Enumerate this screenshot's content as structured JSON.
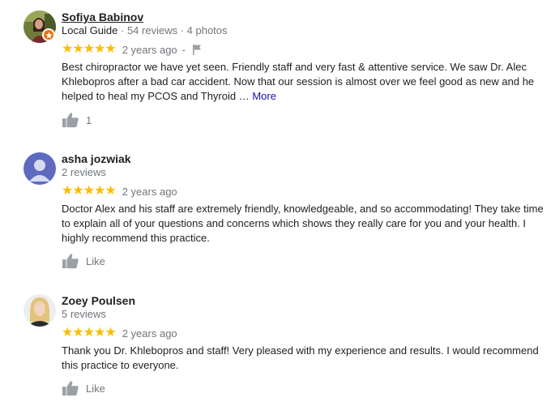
{
  "reviews": [
    {
      "name": "Sofiya Babinov",
      "guide_label": "Local Guide",
      "meta": "· 54 reviews · 4 photos",
      "stars": "★★★★★",
      "rating": 5,
      "time": "2 years ago",
      "separator": "-",
      "text": "Best chiropractor we have yet seen. Friendly staff and very fast & attentive service. We saw Dr. Alec Khlebopros after a bad car accident. Now that our session is almost over we feel good as new and he helped to heal my PCOS and Thyroid … ",
      "more_label": "More",
      "like_label": "1"
    },
    {
      "name": "asha jozwiak",
      "meta": "2 reviews",
      "stars": "★★★★★",
      "rating": 5,
      "time": "2 years ago",
      "text": "Doctor Alex and his staff are extremely friendly, knowledgeable, and so accommodating! They take time to explain all of your questions and concerns which shows they really care for you and your health. I highly recommend this practice.",
      "like_label": "Like"
    },
    {
      "name": "Zoey Poulsen",
      "meta": "5 reviews",
      "stars": "★★★★★",
      "rating": 5,
      "time": "2 years ago",
      "text": "Thank you Dr. Khlebopros and staff! Very pleased with my experience and results. I would recommend this practice to everyone.",
      "like_label": "Like"
    }
  ],
  "colors": {
    "star": "#fbbc04",
    "more_link": "#1a0dab",
    "muted": "#70757a",
    "guide_badge": "#e8710a",
    "default_avatar": "#5c6bc0"
  },
  "icons": [
    "reviewer-photo",
    "local-guide-star-icon",
    "flag-icon",
    "thumbs-up-icon",
    "default-avatar-icon"
  ]
}
